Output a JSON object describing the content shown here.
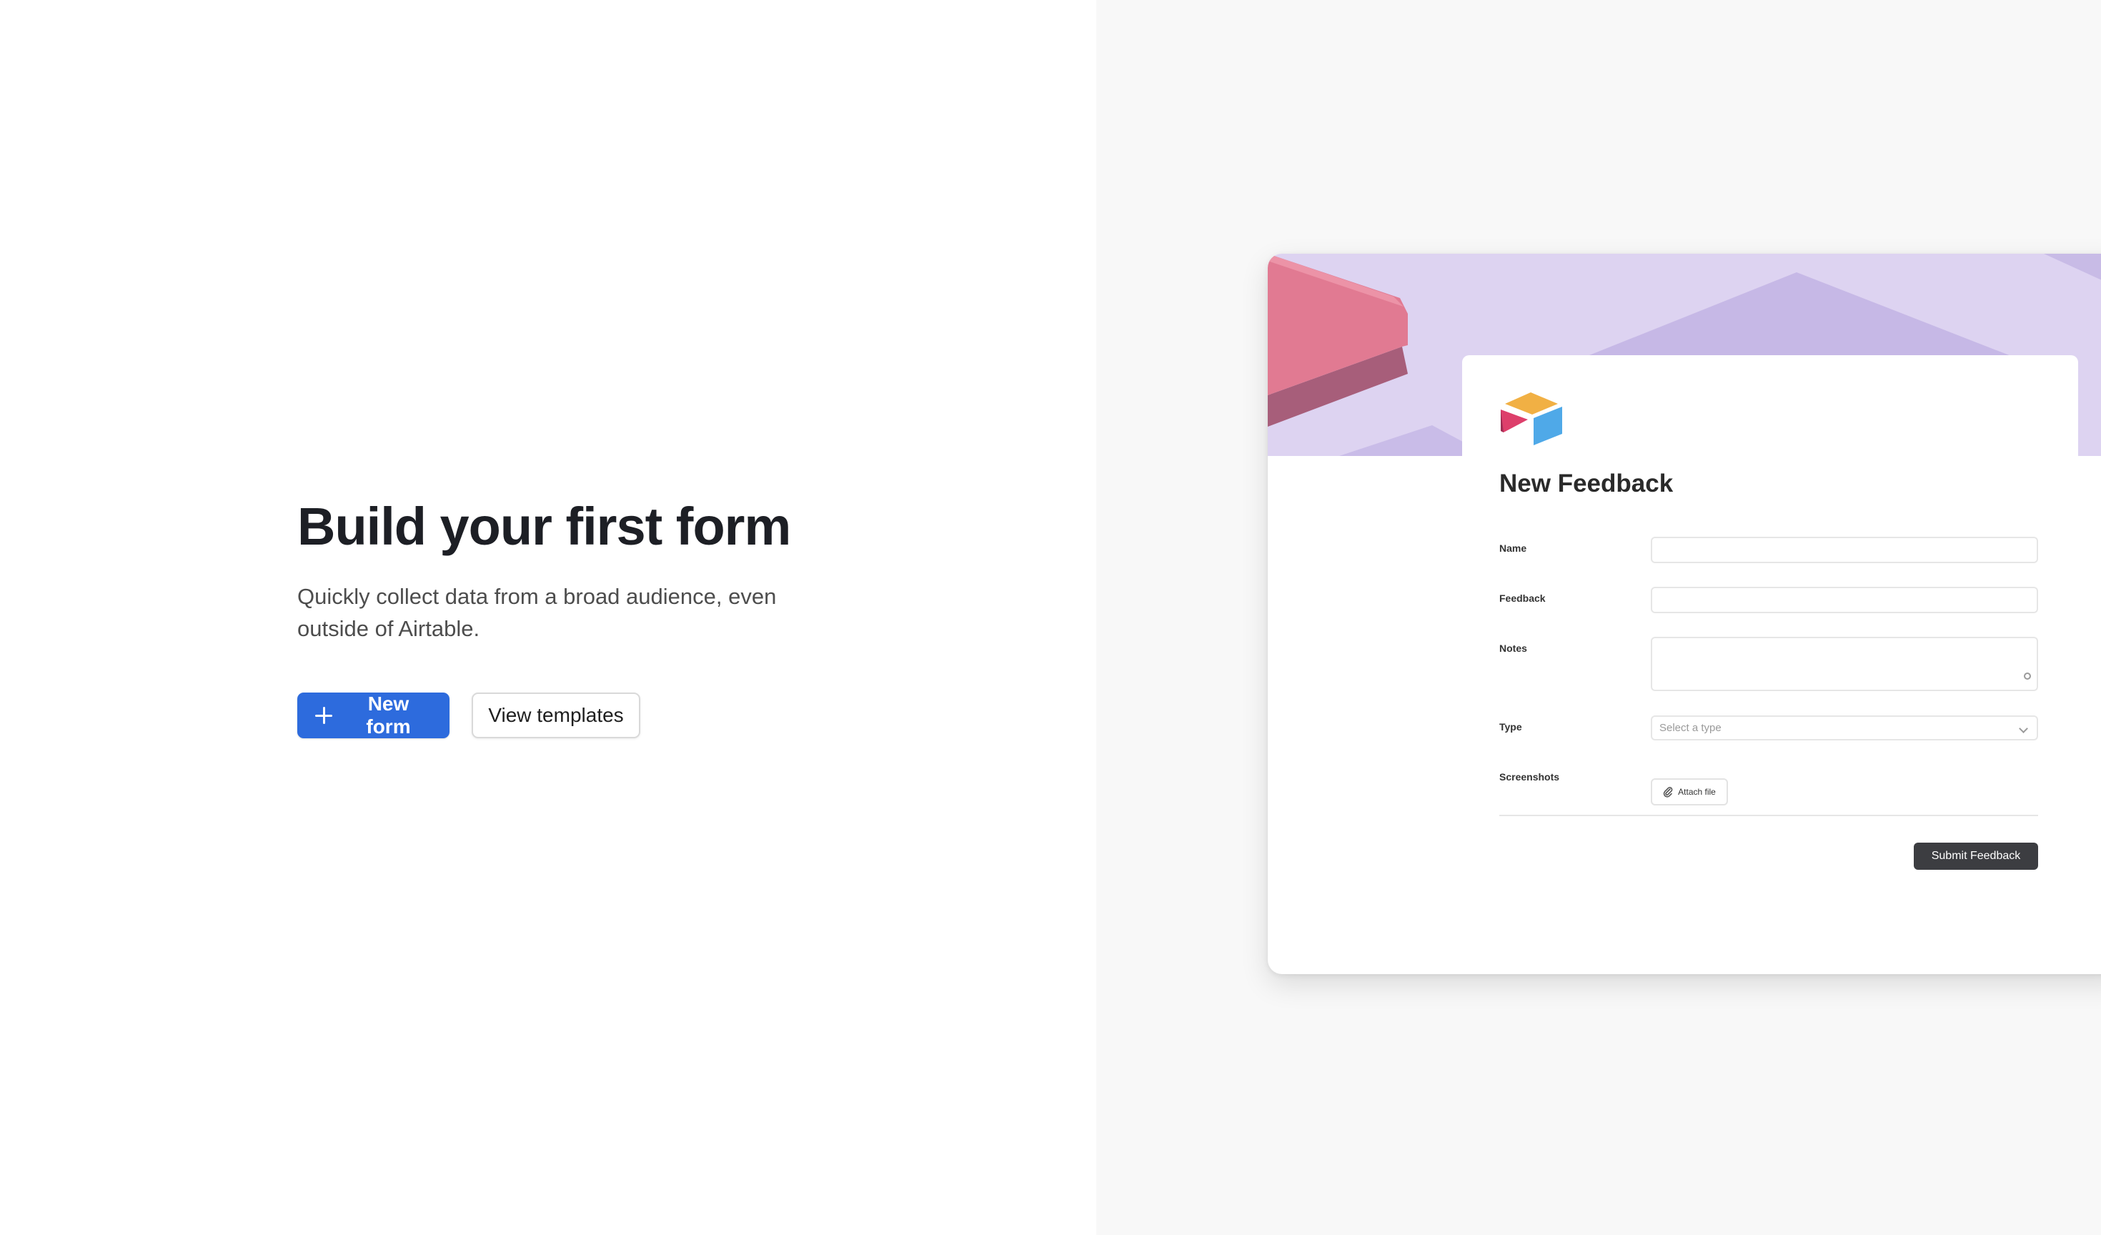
{
  "hero": {
    "title": "Build your first form",
    "description": "Quickly collect data from a broad audience, even outside of Airtable.",
    "primary_button": "New form",
    "secondary_button": "View templates"
  },
  "preview_form": {
    "title": "New Feedback",
    "fields": {
      "name_label": "Name",
      "feedback_label": "Feedback",
      "notes_label": "Notes",
      "type_label": "Type",
      "type_placeholder": "Select a type",
      "screenshots_label": "Screenshots",
      "attach_label": "Attach file"
    },
    "submit_label": "Submit Feedback"
  },
  "colors": {
    "primary_blue": "#2d6bdd",
    "banner_lavender": "#ddd3f1",
    "submit_dark": "#3c3d41",
    "right_panel_bg": "#f8f8f8"
  },
  "icons": [
    "plus-icon",
    "airtable-logo",
    "paperclip-icon",
    "chevron-down-icon",
    "resize-handle-icon"
  ]
}
